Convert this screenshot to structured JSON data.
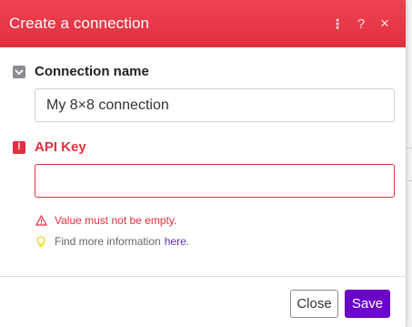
{
  "dialog": {
    "title": "Create a connection",
    "header_icons": [
      "more-vert-icon",
      "help-icon",
      "close-icon"
    ]
  },
  "fields": {
    "connection_name": {
      "label": "Connection name",
      "value": "My 8×8 connection"
    },
    "api_key": {
      "label": "API Key",
      "value": "",
      "error": "Value must not be empty.",
      "info_prefix": "Find more information",
      "info_link": "here",
      "info_suffix": "."
    }
  },
  "footer": {
    "close_label": "Close",
    "save_label": "Save"
  },
  "colors": {
    "header": "#e8394a",
    "error": "#e0303f",
    "primary": "#6a06c8"
  }
}
